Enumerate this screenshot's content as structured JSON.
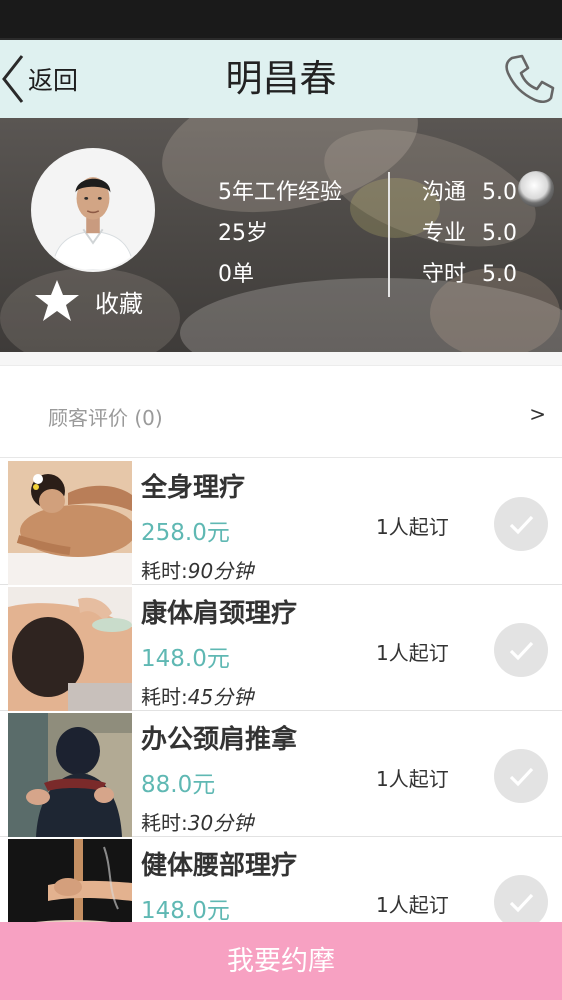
{
  "nav": {
    "back_label": "返回",
    "title": "明昌春",
    "phone_icon": "phone-icon"
  },
  "profile": {
    "favorite_label": "收藏",
    "experience": "5年工作经验",
    "age": "25岁",
    "orders": "0单",
    "ratings": [
      {
        "label": "沟通",
        "score": "5.0"
      },
      {
        "label": "专业",
        "score": "5.0"
      },
      {
        "label": "守时",
        "score": "5.0"
      }
    ]
  },
  "reviews": {
    "label": "顾客评价 (0)",
    "arrow": ">"
  },
  "services": [
    {
      "name": "全身理疗",
      "price": "258.0元",
      "time_prefix": "耗时:",
      "time_value": "90分钟",
      "min_order": "1人起订",
      "icon": "check-icon"
    },
    {
      "name": "康体肩颈理疗",
      "price": "148.0元",
      "time_prefix": "耗时:",
      "time_value": "45分钟",
      "min_order": "1人起订",
      "icon": "check-icon"
    },
    {
      "name": "办公颈肩推拿",
      "price": "88.0元",
      "time_prefix": "耗时:",
      "time_value": "30分钟",
      "min_order": "1人起订",
      "icon": "check-icon"
    },
    {
      "name": "健体腰部理疗",
      "price": "148.0元",
      "time_prefix": "",
      "time_value": "",
      "min_order": "1人起订",
      "icon": "check-icon"
    }
  ],
  "footer": {
    "book_label": "我要约摩"
  },
  "colors": {
    "nav_bg": "#dff1f0",
    "price": "#5fb8b3",
    "book_button": "#f7a1c2",
    "status_bar": "#1a1a1a"
  }
}
